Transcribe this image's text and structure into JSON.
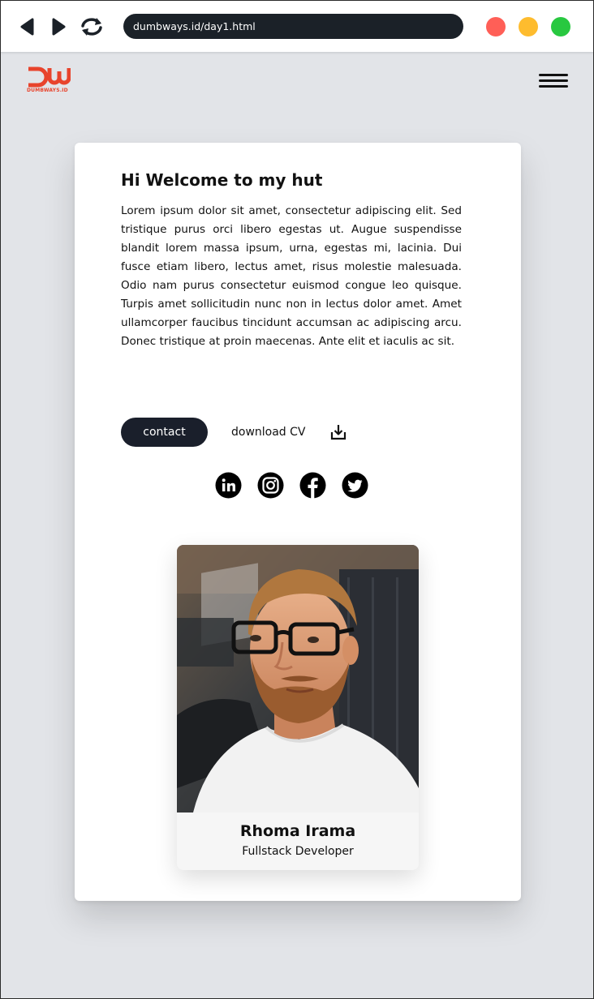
{
  "browser": {
    "url": "dumbways.id/day1.html",
    "back_icon": "back-arrow-icon",
    "forward_icon": "forward-arrow-icon",
    "reload_icon": "reload-icon",
    "window_controls": {
      "close_color": "#ff5f57",
      "minimize_color": "#febc2e",
      "maximize_color": "#28c840"
    }
  },
  "header": {
    "logo_text": "DUMBWAYS.ID",
    "logo_color": "#e8432c",
    "menu_icon": "hamburger-menu-icon"
  },
  "intro": {
    "heading": "Hi Welcome to my hut",
    "paragraph": "Lorem ipsum dolor sit amet, consectetur adipiscing elit. Sed tristique purus orci libero egestas ut. Augue suspendisse blandit lorem massa ipsum, urna, egestas mi, lacinia. Dui fusce etiam libero, lectus amet, risus molestie malesuada. Odio nam purus consectetur euismod congue leo quisque. Turpis amet sollicitudin nunc non in lectus dolor amet. Amet ullamcorper faucibus tincidunt accumsan ac adipiscing arcu. Donec tristique at proin maecenas. Ante elit et iaculis ac sit.",
    "contact_label": "contact",
    "download_label": "download CV",
    "accent_color": "#1a1f2b"
  },
  "social": [
    {
      "icon": "linkedin-icon"
    },
    {
      "icon": "instagram-icon"
    },
    {
      "icon": "facebook-icon"
    },
    {
      "icon": "twitter-icon"
    }
  ],
  "profile": {
    "name": "Rhoma Irama",
    "role": "Fullstack Developer"
  }
}
